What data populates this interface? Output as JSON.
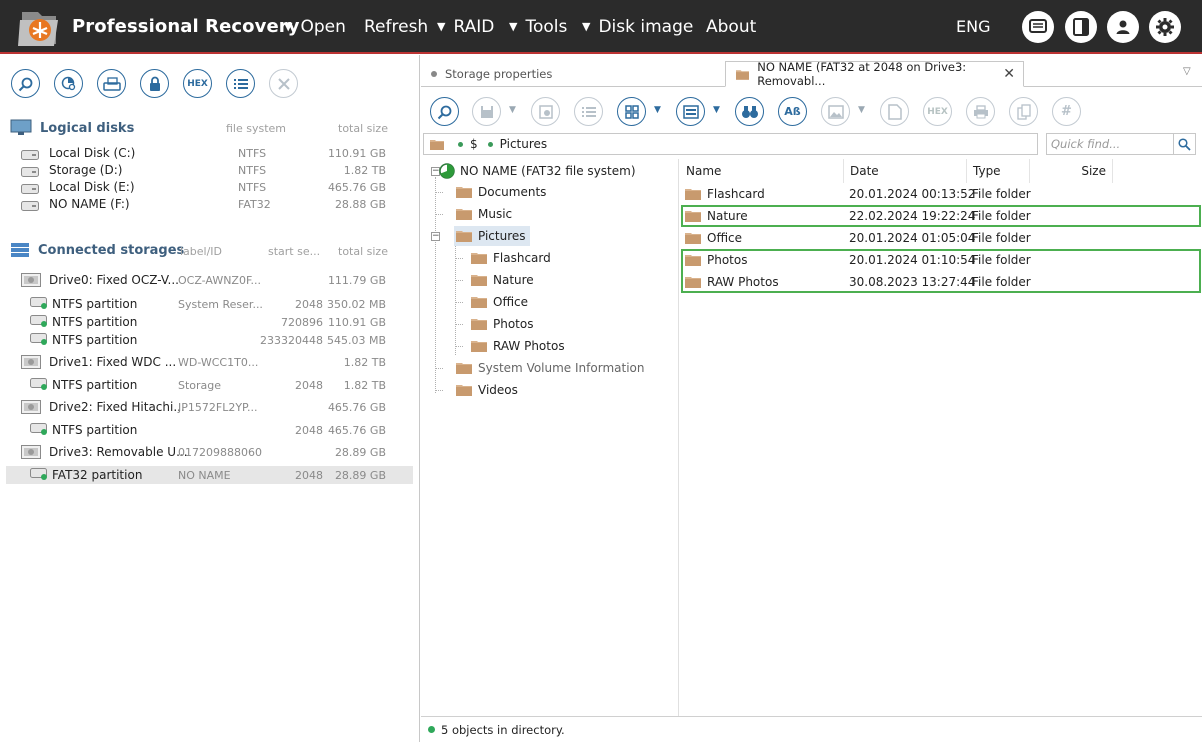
{
  "app": {
    "title": "Professional Recovery",
    "menu": [
      {
        "label": "Open",
        "has_arrow": true
      },
      {
        "label": "Refresh",
        "has_arrow": false
      },
      {
        "label": "RAID",
        "has_arrow": true
      },
      {
        "label": "Tools",
        "has_arrow": true
      },
      {
        "label": "Disk image",
        "has_arrow": true
      },
      {
        "label": "About",
        "has_arrow": false
      }
    ],
    "language": "ENG",
    "top_icons": [
      "messages-icon",
      "panel-toggle-icon",
      "user-icon",
      "settings-gear-icon"
    ]
  },
  "left_panel": {
    "toolbar_icons": [
      "scan-icon",
      "partition-search-icon",
      "disk-image-icon",
      "lock-icon",
      "hex-icon",
      "list-icon",
      "close-icon"
    ],
    "hex_label": "HEX",
    "logical_disks": {
      "title": "Logical disks",
      "col_fs": "file system",
      "col_size": "total size",
      "items": [
        {
          "name": "Local Disk (C:)",
          "fs": "NTFS",
          "size": "110.91 GB"
        },
        {
          "name": "Storage (D:)",
          "fs": "NTFS",
          "size": "1.82 TB"
        },
        {
          "name": "Local Disk (E:)",
          "fs": "NTFS",
          "size": "465.76 GB"
        },
        {
          "name": "NO NAME (F:)",
          "fs": "FAT32",
          "size": "28.88 GB"
        }
      ]
    },
    "connected_storages": {
      "title": "Connected storages",
      "col_label": "label/ID",
      "col_start": "start se...",
      "col_size": "total size",
      "items": [
        {
          "type": "drive",
          "name": "Drive0: Fixed OCZ-V...",
          "label": "OCZ-AWNZ0F...",
          "start": "",
          "size": "111.79 GB"
        },
        {
          "type": "partition",
          "name": "NTFS partition",
          "label": "System Reser...",
          "start": "2048",
          "size": "350.02 MB"
        },
        {
          "type": "partition",
          "name": "NTFS partition",
          "label": "",
          "start": "720896",
          "size": "110.91 GB"
        },
        {
          "type": "partition",
          "name": "NTFS partition",
          "label": "",
          "start": "233320448",
          "size": "545.03 MB"
        },
        {
          "type": "drive",
          "name": "Drive1: Fixed WDC ...",
          "label": "WD-WCC1T0...",
          "start": "",
          "size": "1.82 TB"
        },
        {
          "type": "partition",
          "name": "NTFS partition",
          "label": "Storage",
          "start": "2048",
          "size": "1.82 TB"
        },
        {
          "type": "drive",
          "name": "Drive2: Fixed Hitachi...",
          "label": "JP1572FL2YP...",
          "start": "",
          "size": "465.76 GB"
        },
        {
          "type": "partition",
          "name": "NTFS partition",
          "label": "",
          "start": "2048",
          "size": "465.76 GB"
        },
        {
          "type": "drive",
          "name": "Drive3: Removable U...",
          "label": "017209888060",
          "start": "",
          "size": "28.89 GB"
        },
        {
          "type": "partition",
          "name": "FAT32 partition",
          "label": "NO NAME",
          "start": "2048",
          "size": "28.89 GB",
          "selected": true
        }
      ]
    }
  },
  "right_panel": {
    "tabs": [
      {
        "label": "Storage properties",
        "active": false
      },
      {
        "label": "NO NAME (FAT32 at 2048 on Drive3: Removabl...",
        "active": true
      }
    ],
    "toolbar_icons": [
      "scan-icon",
      "save-icon",
      "save-options-icon",
      "checklist-icon",
      "view-mode-icon",
      "preview-icon",
      "binoculars-icon",
      "case-icon",
      "image-preview-icon",
      "export-icon",
      "hex-icon",
      "print-icon",
      "copy-icon",
      "hash-icon"
    ],
    "hex_label": "HEX",
    "case_label": "Aß",
    "path": {
      "root": "$",
      "folder": "Pictures"
    },
    "quick_find_placeholder": "Quick find...",
    "tree": {
      "root": "NO NAME (FAT32 file system)",
      "nodes": [
        {
          "label": "Documents",
          "level": 1
        },
        {
          "label": "Music",
          "level": 1
        },
        {
          "label": "Pictures",
          "level": 1,
          "expanded": true,
          "selected": true
        },
        {
          "label": "Flashcard",
          "level": 2
        },
        {
          "label": "Nature",
          "level": 2
        },
        {
          "label": "Office",
          "level": 2
        },
        {
          "label": "Photos",
          "level": 2
        },
        {
          "label": "RAW Photos",
          "level": 2
        },
        {
          "label": "System Volume Information",
          "level": 1,
          "muted": true
        },
        {
          "label": "Videos",
          "level": 1
        }
      ]
    },
    "file_list": {
      "columns": {
        "name": "Name",
        "date": "Date",
        "type": "Type",
        "size": "Size"
      },
      "rows": [
        {
          "name": "Flashcard",
          "date": "20.01.2024 00:13:52",
          "type": "File folder",
          "highlighted": false
        },
        {
          "name": "Nature",
          "date": "22.02.2024 19:22:24",
          "type": "File folder",
          "highlighted": true
        },
        {
          "name": "Office",
          "date": "20.01.2024 01:05:04",
          "type": "File folder",
          "highlighted": false
        },
        {
          "name": "Photos",
          "date": "20.01.2024 01:10:54",
          "type": "File folder",
          "highlighted": true
        },
        {
          "name": "RAW Photos",
          "date": "30.08.2023 13:27:44",
          "type": "File folder",
          "highlighted": true
        }
      ]
    },
    "status": "5 objects in directory."
  },
  "colors": {
    "titlebar": "#2b2b2b",
    "accent": "#2d6b9e",
    "highlight": "#4caf50",
    "folder": "#d4a574"
  }
}
